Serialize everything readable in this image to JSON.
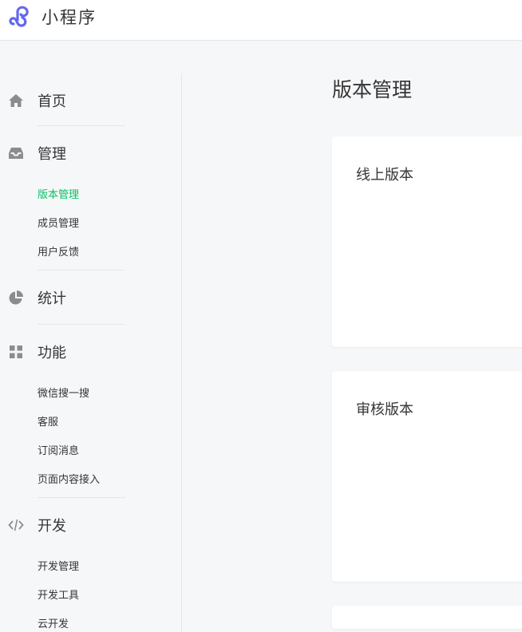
{
  "header": {
    "title": "小程序",
    "logo_icon": "miniprogram-logo-icon",
    "brand_color": "#6467f0"
  },
  "sidebar": {
    "sections": [
      {
        "label": "首页",
        "icon": "home-icon",
        "items": []
      },
      {
        "label": "管理",
        "icon": "inbox-icon",
        "items": [
          "版本管理",
          "成员管理",
          "用户反馈"
        ]
      },
      {
        "label": "统计",
        "icon": "pie-chart-icon",
        "items": []
      },
      {
        "label": "功能",
        "icon": "grid-icon",
        "items": [
          "微信搜一搜",
          "客服",
          "订阅消息",
          "页面内容接入"
        ]
      },
      {
        "label": "开发",
        "icon": "code-icon",
        "items": [
          "开发管理",
          "开发工具",
          "云开发"
        ]
      }
    ],
    "active_item": "版本管理",
    "active_color": "#07c160"
  },
  "main": {
    "page_title": "版本管理",
    "cards": [
      {
        "title": "线上版本"
      },
      {
        "title": "审核版本"
      },
      {
        "title": ""
      }
    ]
  }
}
